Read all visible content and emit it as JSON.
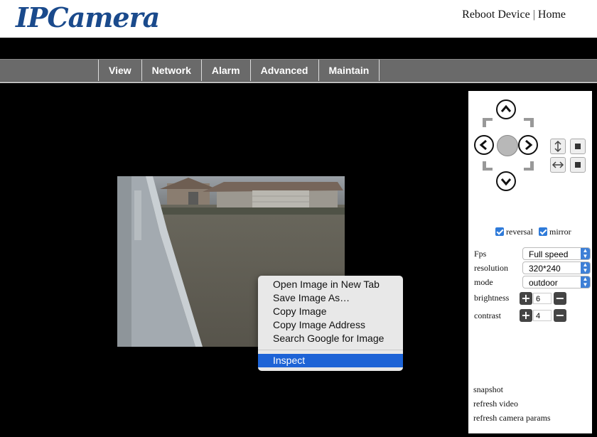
{
  "header": {
    "logo": "IPCamera",
    "reboot_label": "Reboot Device",
    "separator": "|",
    "home_label": "Home"
  },
  "nav": {
    "items": [
      {
        "label": "View"
      },
      {
        "label": "Network"
      },
      {
        "label": "Alarm"
      },
      {
        "label": "Advanced"
      },
      {
        "label": "Maintain"
      }
    ]
  },
  "panel": {
    "checkboxes": {
      "reversal": {
        "label": "reversal",
        "checked": true
      },
      "mirror": {
        "label": "mirror",
        "checked": true
      }
    },
    "fps": {
      "label": "Fps",
      "value": "Full speed"
    },
    "resolution": {
      "label": "resolution",
      "value": "320*240"
    },
    "mode": {
      "label": "mode",
      "value": "outdoor"
    },
    "brightness": {
      "label": "brightness",
      "value": "6"
    },
    "contrast": {
      "label": "contrast",
      "value": "4"
    },
    "links": {
      "snapshot": "snapshot",
      "refresh_video": "refresh video",
      "refresh_params": "refresh camera params"
    }
  },
  "context_menu": {
    "items": [
      {
        "label": "Open Image in New Tab"
      },
      {
        "label": "Save Image As…"
      },
      {
        "label": "Copy Image"
      },
      {
        "label": "Copy Image Address"
      },
      {
        "label": "Search Google for Image"
      }
    ],
    "inspect": "Inspect"
  },
  "colors": {
    "accent": "#1d63d6",
    "logo": "#1a4a8c",
    "nav_bg": "#6a6a6a"
  }
}
